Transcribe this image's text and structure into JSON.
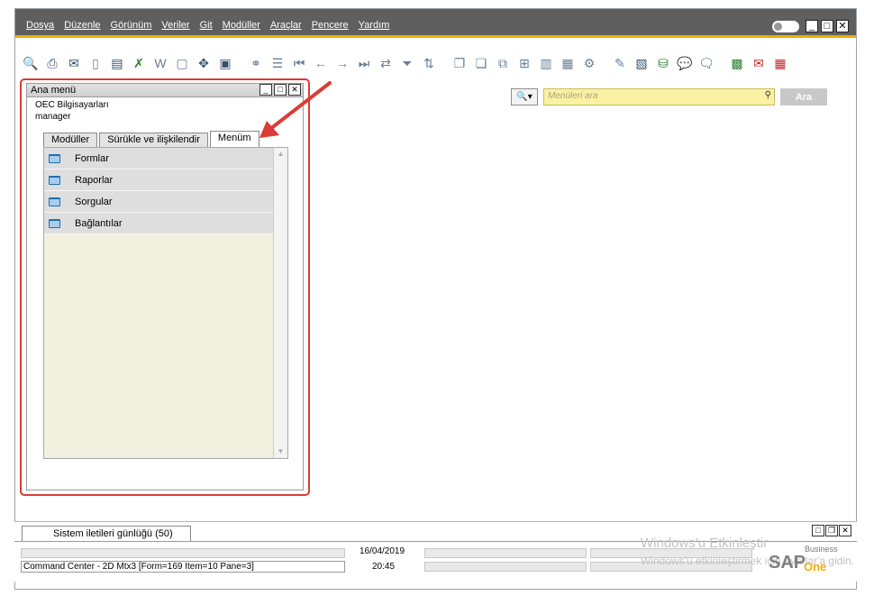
{
  "menubar": {
    "items": [
      "Dosya",
      "Düzenle",
      "Görünüm",
      "Veriler",
      "Git",
      "Modüller",
      "Araçlar",
      "Pencere",
      "Yardım"
    ]
  },
  "toolbar": {
    "icons": [
      "preview-icon",
      "print-icon",
      "email-icon",
      "sms-icon",
      "fax-icon",
      "excel-icon",
      "word-icon",
      "pdf-icon",
      "move-icon",
      "lock-icon",
      "binoculars-icon",
      "document-icon",
      "first-record-icon",
      "previous-record-icon",
      "next-record-icon",
      "last-record-icon",
      "refresh-icon",
      "filter-icon",
      "sort-icon",
      "copy-icon",
      "paste-icon",
      "duplicate-icon",
      "copy-to-icon",
      "chart-icon",
      "table-icon",
      "settings-icon",
      "edit-icon",
      "new-document-icon",
      "database-icon",
      "message-icon",
      "chat-icon",
      "calendar-icon",
      "alert-icon",
      "grid-icon"
    ]
  },
  "search": {
    "placeholder": "Menüleri ara",
    "button_label": "Ara"
  },
  "main_menu": {
    "title": "Ana menü",
    "company": "OEC Bilgisayarları",
    "user": "manager",
    "tabs": [
      "Modüller",
      "Sürükle ve ilişkilendir",
      "Menüm"
    ],
    "active_tab": "Menüm",
    "items": [
      "Formlar",
      "Raporlar",
      "Sorgular",
      "Bağlantılar"
    ]
  },
  "bottom": {
    "log_tab": "Sistem iletileri günlüğü (50)",
    "date": "16/04/2019",
    "time": "20:45",
    "command": "Command Center - 2D Mtx3 [Form=169 Item=10 Pane=3]"
  },
  "watermark": {
    "line1": "Windows'u Etkinleştir",
    "line2": "Windows'u etkinleştirmek için Ayarlar'a gidin."
  },
  "brand": {
    "sap": "SAP",
    "business": "Business",
    "one": "One"
  },
  "colors": {
    "accent": "#f0ab00",
    "menubar": "#5f5f5f",
    "highlight_frame": "#d93d35",
    "search_bg": "#fbf1a4"
  }
}
